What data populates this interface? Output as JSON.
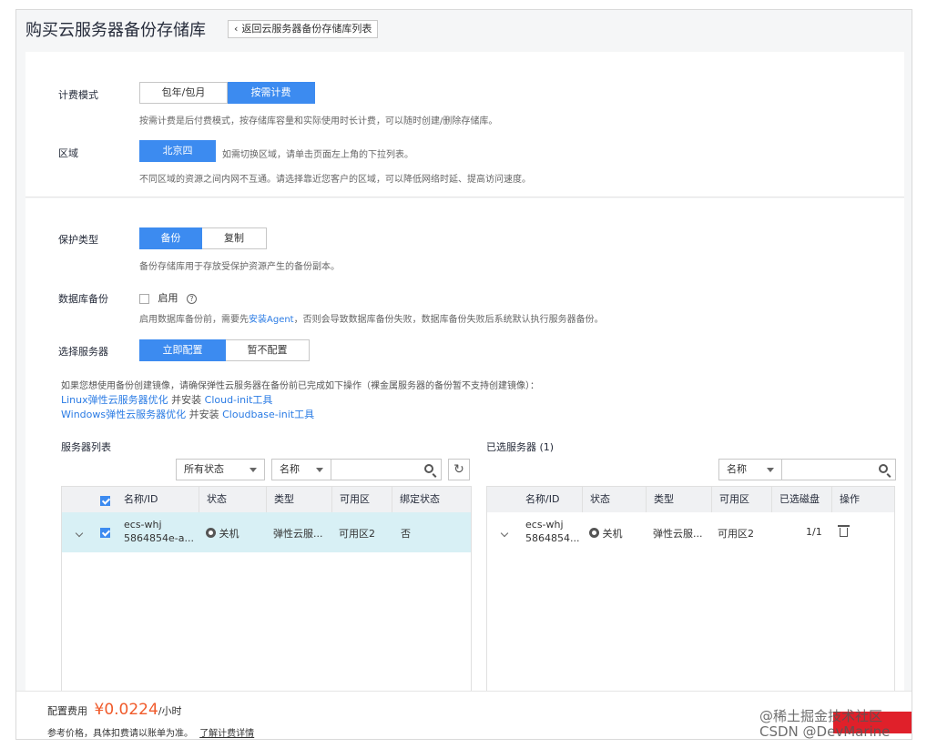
{
  "header": {
    "title": "购买云服务器备份存储库",
    "back_label": "返回云服务器备份存储库列表"
  },
  "billing": {
    "label": "计费模式",
    "options": [
      "包年/包月",
      "按需计费"
    ],
    "selected": "按需计费",
    "hint": "按需计费是后付费模式，按存储库容量和实际使用时长计费，可以随时创建/删除存储库。"
  },
  "region": {
    "label": "区域",
    "value": "北京四",
    "inline_hint": "如需切换区域，请单击页面左上角的下拉列表。",
    "hint": "不同区域的资源之间内网不互通。请选择靠近您客户的区域，可以降低网络时延、提高访问速度。"
  },
  "protection": {
    "label": "保护类型",
    "options": [
      "备份",
      "复制"
    ],
    "selected": "备份",
    "hint": "备份存储库用于存放受保护资源产生的备份副本。"
  },
  "db_backup": {
    "label": "数据库备份",
    "checkbox_label": "启用",
    "checked": false,
    "hint_prefix": "启用数据库备份前，需要先",
    "hint_link": "安装Agent",
    "hint_suffix": "，否则会导致数据库备份失败，数据库备份失败后系统默认执行服务器备份。"
  },
  "server_select": {
    "label": "选择服务器",
    "options": [
      "立即配置",
      "暂不配置"
    ],
    "selected": "立即配置"
  },
  "image_note": {
    "text": "如果您想使用备份创建镜像，请确保弹性云服务器在备份前已完成如下操作（裸金属服务器的备份暂不支持创建镜像）：",
    "line1_link": "Linux弹性云服务器优化",
    "line1_mid": " 并安装 ",
    "line1_link2": "Cloud-init工具",
    "line2_link": "Windows弹性云服务器优化",
    "line2_mid": " 并安装 ",
    "line2_link2": "Cloudbase-init工具"
  },
  "server_list": {
    "title": "服务器列表",
    "status_filter": "所有状态",
    "search_field": "名称",
    "columns": [
      "名称/ID",
      "状态",
      "类型",
      "可用区",
      "绑定状态"
    ],
    "rows": [
      {
        "name": "ecs-whj",
        "id": "5864854e-a...",
        "status": "关机",
        "type": "弹性云服...",
        "az": "可用区2",
        "bind": "否",
        "checked": true
      }
    ]
  },
  "selected_list": {
    "title": "已选服务器 (1)",
    "search_field": "名称",
    "columns": [
      "名称/ID",
      "状态",
      "类型",
      "可用区",
      "已选磁盘",
      "操作"
    ],
    "rows": [
      {
        "name": "ecs-whj",
        "id": "58648​54...",
        "status": "关机",
        "type": "弹性云服...",
        "az": "可用区2",
        "disks": "1/1"
      }
    ]
  },
  "footer": {
    "price_label": "配置费用",
    "price": "¥0.0224",
    "unit": "/小时",
    "note": "参考价格，具体扣费请以账单为准。",
    "note_link": "了解计费详情"
  },
  "watermark": {
    "line1": "@稀土掘金技术社区",
    "line2": "CSDN @DevMarine"
  },
  "colors": {
    "primary": "#3c8bf0",
    "price": "#f05a2a",
    "link": "#2a7be4",
    "selected_row": "#d8f0f5"
  }
}
